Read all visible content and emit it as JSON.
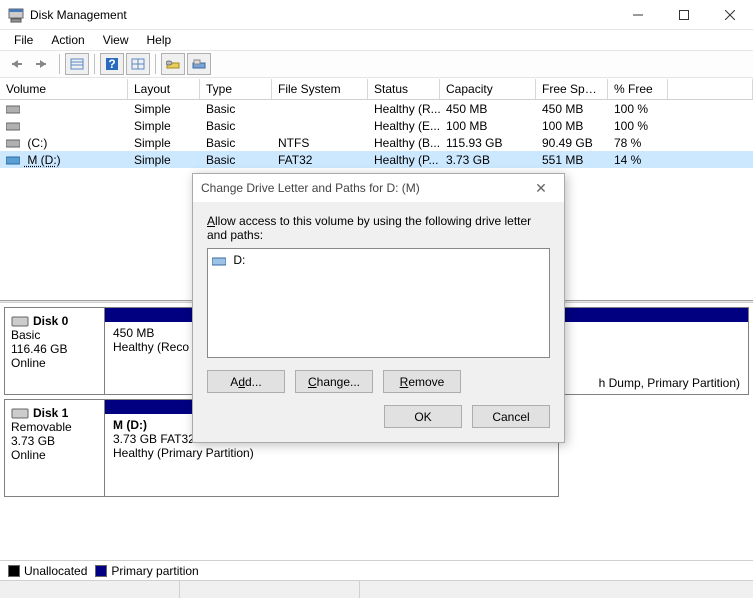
{
  "window": {
    "title": "Disk Management"
  },
  "menu": {
    "file": "File",
    "action": "Action",
    "view": "View",
    "help": "Help"
  },
  "columns": {
    "volume": "Volume",
    "layout": "Layout",
    "type": "Type",
    "fs": "File System",
    "status": "Status",
    "capacity": "Capacity",
    "free": "Free Spa...",
    "pct": "% Free"
  },
  "rows": [
    {
      "vol": "",
      "layout": "Simple",
      "type": "Basic",
      "fs": "",
      "status": "Healthy (R...",
      "cap": "450 MB",
      "free": "450 MB",
      "pct": "100 %"
    },
    {
      "vol": "",
      "layout": "Simple",
      "type": "Basic",
      "fs": "",
      "status": "Healthy (E...",
      "cap": "100 MB",
      "free": "100 MB",
      "pct": "100 %"
    },
    {
      "vol": " (C:)",
      "layout": "Simple",
      "type": "Basic",
      "fs": "NTFS",
      "status": "Healthy (B...",
      "cap": "115.93 GB",
      "free": "90.49 GB",
      "pct": "78 %"
    },
    {
      "vol": " M (D:)",
      "layout": "Simple",
      "type": "Basic",
      "fs": "FAT32",
      "status": "Healthy (P...",
      "cap": "3.73 GB",
      "free": "551 MB",
      "pct": "14 %"
    }
  ],
  "disks": [
    {
      "name": "Disk 0",
      "type": "Basic",
      "size": "116.46 GB",
      "state": "Online",
      "vol_name": "450 MB",
      "vol_line2": "",
      "vol_status_full": "Healthy (Recovery Partition)",
      "vol_status_cut_left": "Healthy (Reco",
      "vol_status_cut_right": "h Dump, Primary Partition)"
    },
    {
      "name": "Disk 1",
      "type": "Removable",
      "size": "3.73 GB",
      "state": "Online",
      "vol_name": "M  (D:)",
      "vol_line2": "3.73 GB FAT32",
      "vol_status": "Healthy (Primary Partition)"
    }
  ],
  "legend": {
    "unallocated": "Unallocated",
    "primary": "Primary partition"
  },
  "dialog": {
    "title": "Change Drive Letter and Paths for D: (M)",
    "instruction": "Allow access to this volume by using the following drive letter and paths:",
    "entry": "D:",
    "add": "Add...",
    "change": "Change...",
    "remove": "Remove",
    "ok": "OK",
    "cancel": "Cancel"
  }
}
